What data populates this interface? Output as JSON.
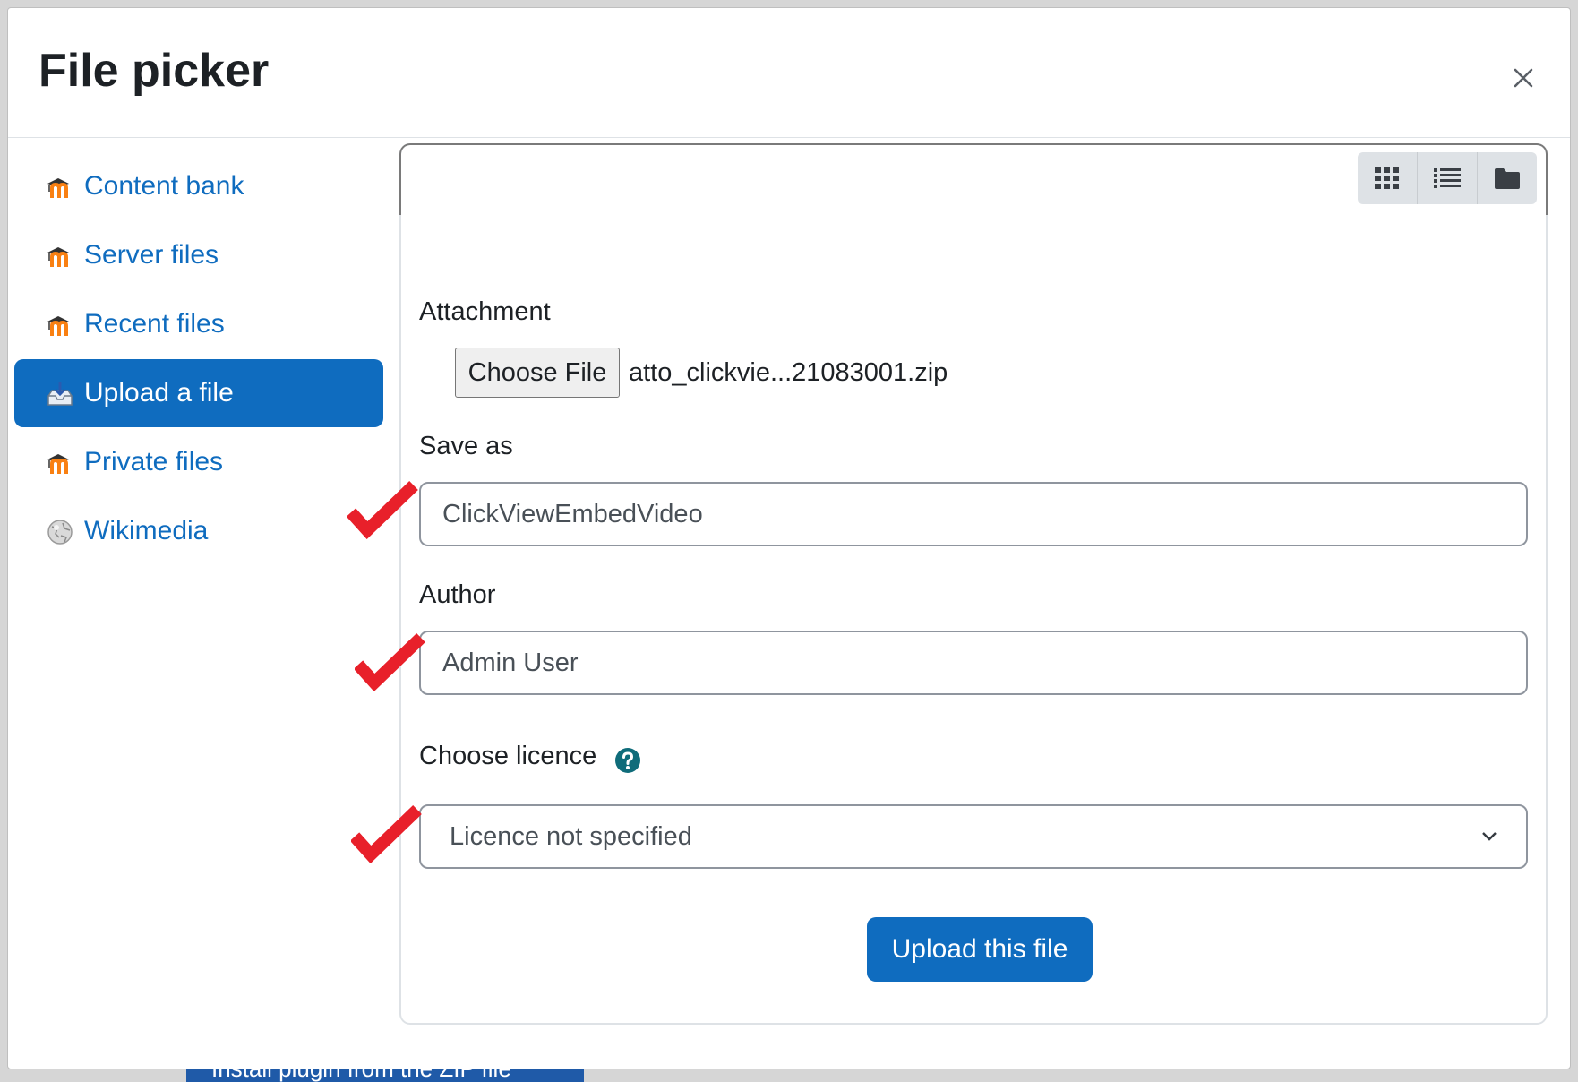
{
  "background": {
    "partial_button_label": "Install plugin from the ZIP file"
  },
  "dialog": {
    "title": "File picker",
    "close_icon": "close-icon"
  },
  "sidebar": {
    "items": [
      {
        "label": "Content bank",
        "icon": "moodle-repository-icon",
        "active": false
      },
      {
        "label": "Server files",
        "icon": "moodle-repository-icon",
        "active": false
      },
      {
        "label": "Recent files",
        "icon": "moodle-repository-icon",
        "active": false
      },
      {
        "label": "Upload a file",
        "icon": "upload-tray-icon",
        "active": true
      },
      {
        "label": "Private files",
        "icon": "moodle-repository-icon",
        "active": false
      },
      {
        "label": "Wikimedia",
        "icon": "wikimedia-globe-icon",
        "active": false
      }
    ]
  },
  "toolbar": {
    "view_buttons": [
      {
        "icon": "grid-view-icon"
      },
      {
        "icon": "list-view-icon"
      },
      {
        "icon": "folder-view-icon"
      }
    ]
  },
  "form": {
    "attachment_label": "Attachment",
    "choose_file_label": "Choose File",
    "file_name": "atto_clickvie...21083001.zip",
    "save_as_label": "Save as",
    "save_as_value": "ClickViewEmbedVideo",
    "author_label": "Author",
    "author_value": "Admin User",
    "licence_label": "Choose licence",
    "licence_help_icon": "question-circle-icon",
    "licence_value": "Licence not specified",
    "upload_button": "Upload this file"
  },
  "colors": {
    "accent": "#0f6cbf",
    "checkmark": "#e8202a",
    "moodle_orange": "#f98012"
  }
}
